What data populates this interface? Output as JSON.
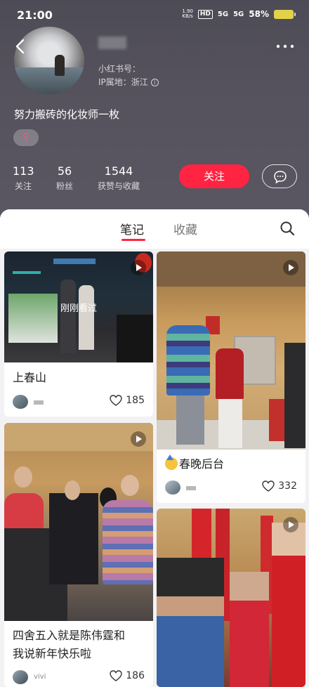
{
  "status_bar": {
    "time": "21:00",
    "net_speed": "1.90",
    "net_unit": "KB/s",
    "hd": "HD",
    "signal_1": "5G",
    "signal_2": "5G",
    "battery": "58%"
  },
  "profile": {
    "redbook_id": "小红书号：",
    "ip_location": "IP属地：浙江",
    "bio": "努力搬砖的化妆师一枚",
    "gender_symbol": "♀",
    "stats": [
      {
        "num": "113",
        "label": "关注"
      },
      {
        "num": "56",
        "label": "粉丝"
      },
      {
        "num": "1544",
        "label": "获赞与收藏"
      }
    ],
    "follow_label": "关注"
  },
  "tabs": {
    "notes": "笔记",
    "collections": "收藏"
  },
  "notes": [
    {
      "title": "上春山",
      "seen_label": "刚刚看过",
      "likes": "185",
      "author": ""
    },
    {
      "title": "春晚后台",
      "likes": "332",
      "author": ""
    },
    {
      "title": "四舍五入就是陈伟霆和我说新年快乐啦",
      "title_line1": "四舍五入就是陈伟霆和",
      "title_line2": "我说新年快乐啦",
      "likes": "186",
      "author": "vivi"
    }
  ],
  "colors": {
    "accent": "#ff2442",
    "header_bg": "#55525d"
  }
}
